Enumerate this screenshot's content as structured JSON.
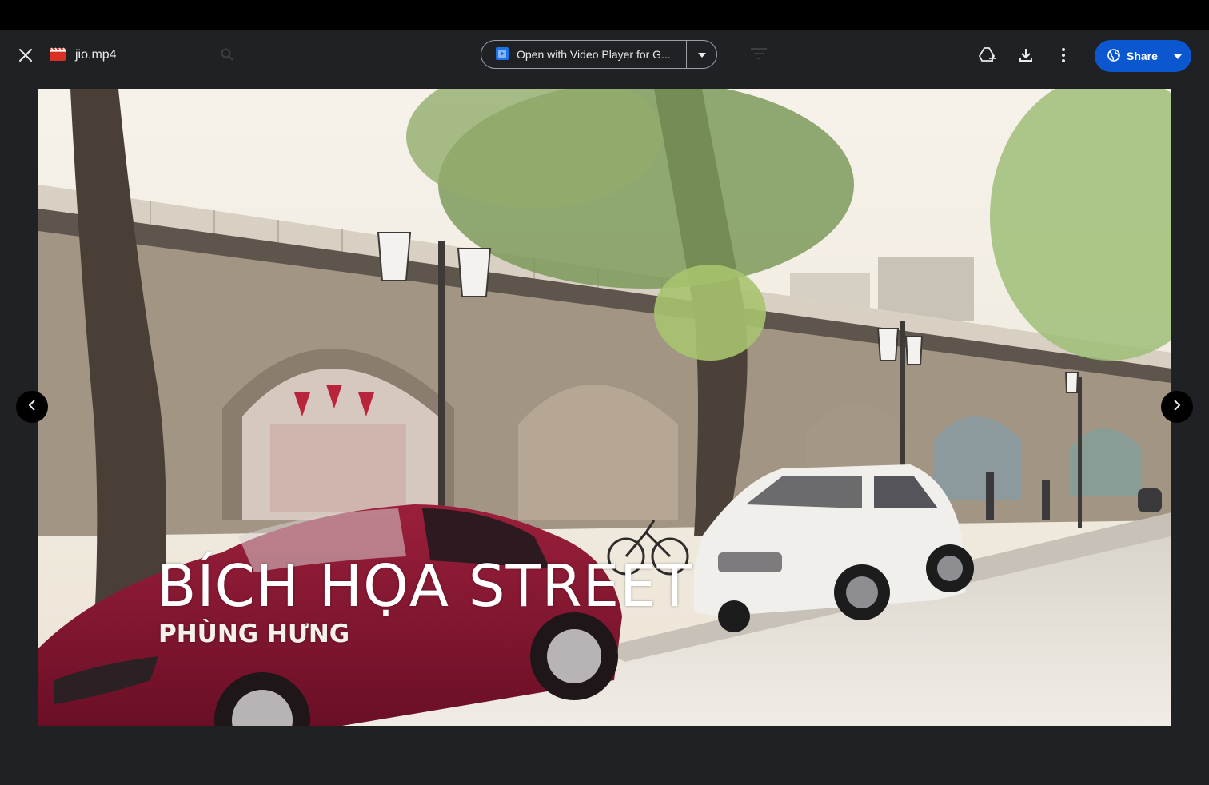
{
  "file": {
    "name": "jio.mp4",
    "icon": "video-file-icon",
    "icon_color": "#d93025"
  },
  "toolbar": {
    "close_icon": "close-icon",
    "open_with_label": "Open with Video Player for G...",
    "open_with_icon": "video-player-app-icon",
    "open_with_caret_icon": "chevron-down-icon",
    "add_to_drive_icon": "add-to-drive-icon",
    "download_icon": "download-icon",
    "more_icon": "more-vert-icon",
    "share_label": "Share",
    "share_icon": "globe-icon",
    "share_caret_icon": "chevron-down-icon",
    "share_color": "#0b57d0"
  },
  "video": {
    "title_overlay": "BÍCH HỌA STREET",
    "subtitle_overlay": "PHÙNG HƯNG"
  },
  "navigation": {
    "previous_icon": "chevron-left-icon",
    "next_icon": "chevron-right-icon"
  }
}
